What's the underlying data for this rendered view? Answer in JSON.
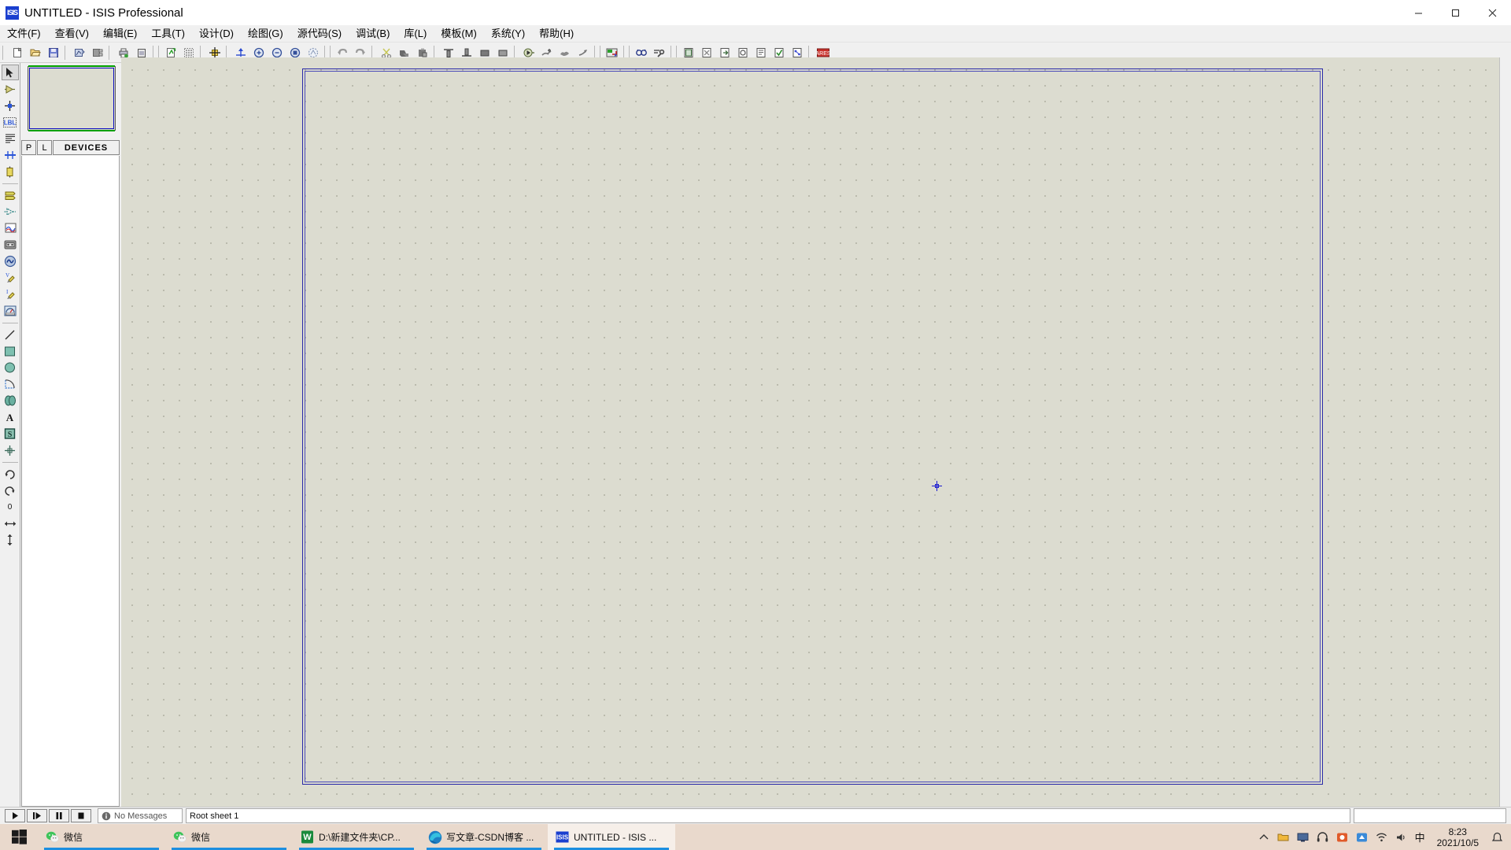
{
  "window": {
    "app_icon_label": "ISIS",
    "title": "UNTITLED - ISIS Professional",
    "minimize": "minimize-icon",
    "maximize": "maximize-icon",
    "close": "close-icon"
  },
  "menubar": {
    "items": [
      {
        "label": "文件(F)",
        "name": "menu-file"
      },
      {
        "label": "查看(V)",
        "name": "menu-view"
      },
      {
        "label": "编辑(E)",
        "name": "menu-edit"
      },
      {
        "label": "工具(T)",
        "name": "menu-tools"
      },
      {
        "label": "设计(D)",
        "name": "menu-design"
      },
      {
        "label": "绘图(G)",
        "name": "menu-graph"
      },
      {
        "label": "源代码(S)",
        "name": "menu-source"
      },
      {
        "label": "调试(B)",
        "name": "menu-debug"
      },
      {
        "label": "库(L)",
        "name": "menu-library"
      },
      {
        "label": "模板(M)",
        "name": "menu-template"
      },
      {
        "label": "系统(Y)",
        "name": "menu-system"
      },
      {
        "label": "帮助(H)",
        "name": "menu-help"
      }
    ]
  },
  "toolbar": {
    "groups": [
      {
        "icons": [
          "new-file-icon",
          "open-file-icon",
          "save-file-icon"
        ]
      },
      {
        "icons": [
          "import-section-icon",
          "export-section-icon"
        ]
      },
      {
        "icons": [
          "print-icon",
          "print-area-icon"
        ]
      },
      {
        "icons": [
          "refresh-display-icon",
          "toggle-grid-icon"
        ]
      },
      {
        "icons": [
          "origin-icon"
        ]
      },
      {
        "icons": [
          "pan-icon",
          "zoom-in-icon",
          "zoom-out-icon",
          "zoom-area-icon",
          "zoom-sheet-icon"
        ]
      },
      {
        "icons": [
          "undo-icon",
          "redo-icon"
        ]
      },
      {
        "icons": [
          "cut-icon",
          "copy-icon",
          "paste-icon"
        ]
      },
      {
        "icons": [
          "block-copy-icon",
          "block-move-icon",
          "block-rotate-icon",
          "block-delete-icon"
        ]
      },
      {
        "icons": [
          "pick-device-icon",
          "make-device-icon",
          "packaging-tool-icon",
          "decompose-icon"
        ]
      },
      {
        "icons": [
          "toggle-devices-panel-icon"
        ]
      },
      {
        "icons": [
          "search-icon",
          "property-assign-icon"
        ]
      },
      {
        "icons": [
          "new-sheet-icon",
          "remove-sheet-icon",
          "exit-sheet-icon",
          "zoom-sheet2-icon",
          "bill-of-materials-icon",
          "electrical-rule-check-icon",
          "netlist-icon"
        ]
      },
      {
        "icons": [
          "ares-icon"
        ]
      }
    ]
  },
  "left_toolstrip": {
    "items": [
      {
        "name": "selection-mode-icon",
        "selected": true
      },
      {
        "name": "component-mode-icon",
        "selected": false
      },
      {
        "name": "junction-dot-icon",
        "selected": false
      },
      {
        "name": "wire-label-icon",
        "selected": false
      },
      {
        "name": "text-script-icon",
        "selected": false
      },
      {
        "name": "bus-mode-icon",
        "selected": false
      },
      {
        "name": "subcircuit-icon",
        "selected": false
      },
      {
        "name": "terminals-icon",
        "selected": false
      },
      {
        "name": "device-pin-icon",
        "selected": false
      },
      {
        "name": "graph-mode-icon",
        "selected": false
      },
      {
        "name": "tape-recorder-icon",
        "selected": false
      },
      {
        "name": "generator-icon",
        "selected": false
      },
      {
        "name": "voltage-probe-icon",
        "selected": false
      },
      {
        "name": "current-probe-icon",
        "selected": false
      },
      {
        "name": "virtual-instrument-icon",
        "selected": false
      },
      {
        "name": "2d-line-icon",
        "selected": false
      },
      {
        "name": "2d-box-icon",
        "selected": false
      },
      {
        "name": "2d-circle-icon",
        "selected": false
      },
      {
        "name": "2d-arc-icon",
        "selected": false
      },
      {
        "name": "2d-path-icon",
        "selected": false
      },
      {
        "name": "2d-text-icon",
        "selected": false
      },
      {
        "name": "2d-symbol-icon",
        "selected": false
      },
      {
        "name": "2d-marker-icon",
        "selected": false
      },
      {
        "name": "rotate-clockwise-icon",
        "selected": false
      },
      {
        "name": "rotate-anticlockwise-icon",
        "selected": false
      },
      {
        "name": "rotation-angle-value",
        "selected": false
      },
      {
        "name": "mirror-horizontal-icon",
        "selected": false
      },
      {
        "name": "mirror-vertical-icon",
        "selected": false
      }
    ],
    "rotation_value": "0"
  },
  "panels": {
    "preview_title": "overview-preview",
    "tabs": [
      {
        "label": "P",
        "name": "tab-p"
      },
      {
        "label": "L",
        "name": "tab-l"
      }
    ],
    "devices_label": "DEVICES",
    "device_items": []
  },
  "statusbar": {
    "animation_buttons": [
      {
        "name": "play-button",
        "glyph": "▶"
      },
      {
        "name": "step-button",
        "glyph": "▮▶"
      },
      {
        "name": "pause-button",
        "glyph": "❚❚"
      },
      {
        "name": "stop-button",
        "glyph": "■"
      }
    ],
    "message_icon": "info-icon",
    "message_text": "No Messages",
    "sheet_text": "Root sheet 1",
    "coordinate_text": ""
  },
  "taskbar": {
    "start_name": "start-button",
    "tasks": [
      {
        "label": "微信",
        "icon": "wechat-icon",
        "active": false,
        "running": true
      },
      {
        "label": "微信",
        "icon": "wechat-icon",
        "active": false,
        "running": true
      },
      {
        "label": "D:\\新建文件夹\\CP...",
        "icon": "wps-icon",
        "active": false,
        "running": true
      },
      {
        "label": "写文章-CSDN博客 ...",
        "icon": "edge-icon",
        "active": false,
        "running": true
      },
      {
        "label": "UNTITLED - ISIS ...",
        "icon": "isis-icon",
        "active": true,
        "running": true
      }
    ],
    "tray_icons": [
      "hidden-icons-icon",
      "folder-icon",
      "screen-icon",
      "headphone-icon",
      "app1-icon",
      "app2-icon",
      "network-icon",
      "volume-icon"
    ],
    "ime_label": "中",
    "clock_time": "8:23",
    "clock_date": "2021/10/5",
    "notification_name": "notification-center-icon"
  },
  "colors": {
    "canvas_bg": "#dcdcd0",
    "sheet_border": "#2a2aa8",
    "taskbar_bg": "#e9d9cc",
    "accent_blue": "#1d8fe0",
    "title_icon_blue": "#1a3fcf"
  }
}
